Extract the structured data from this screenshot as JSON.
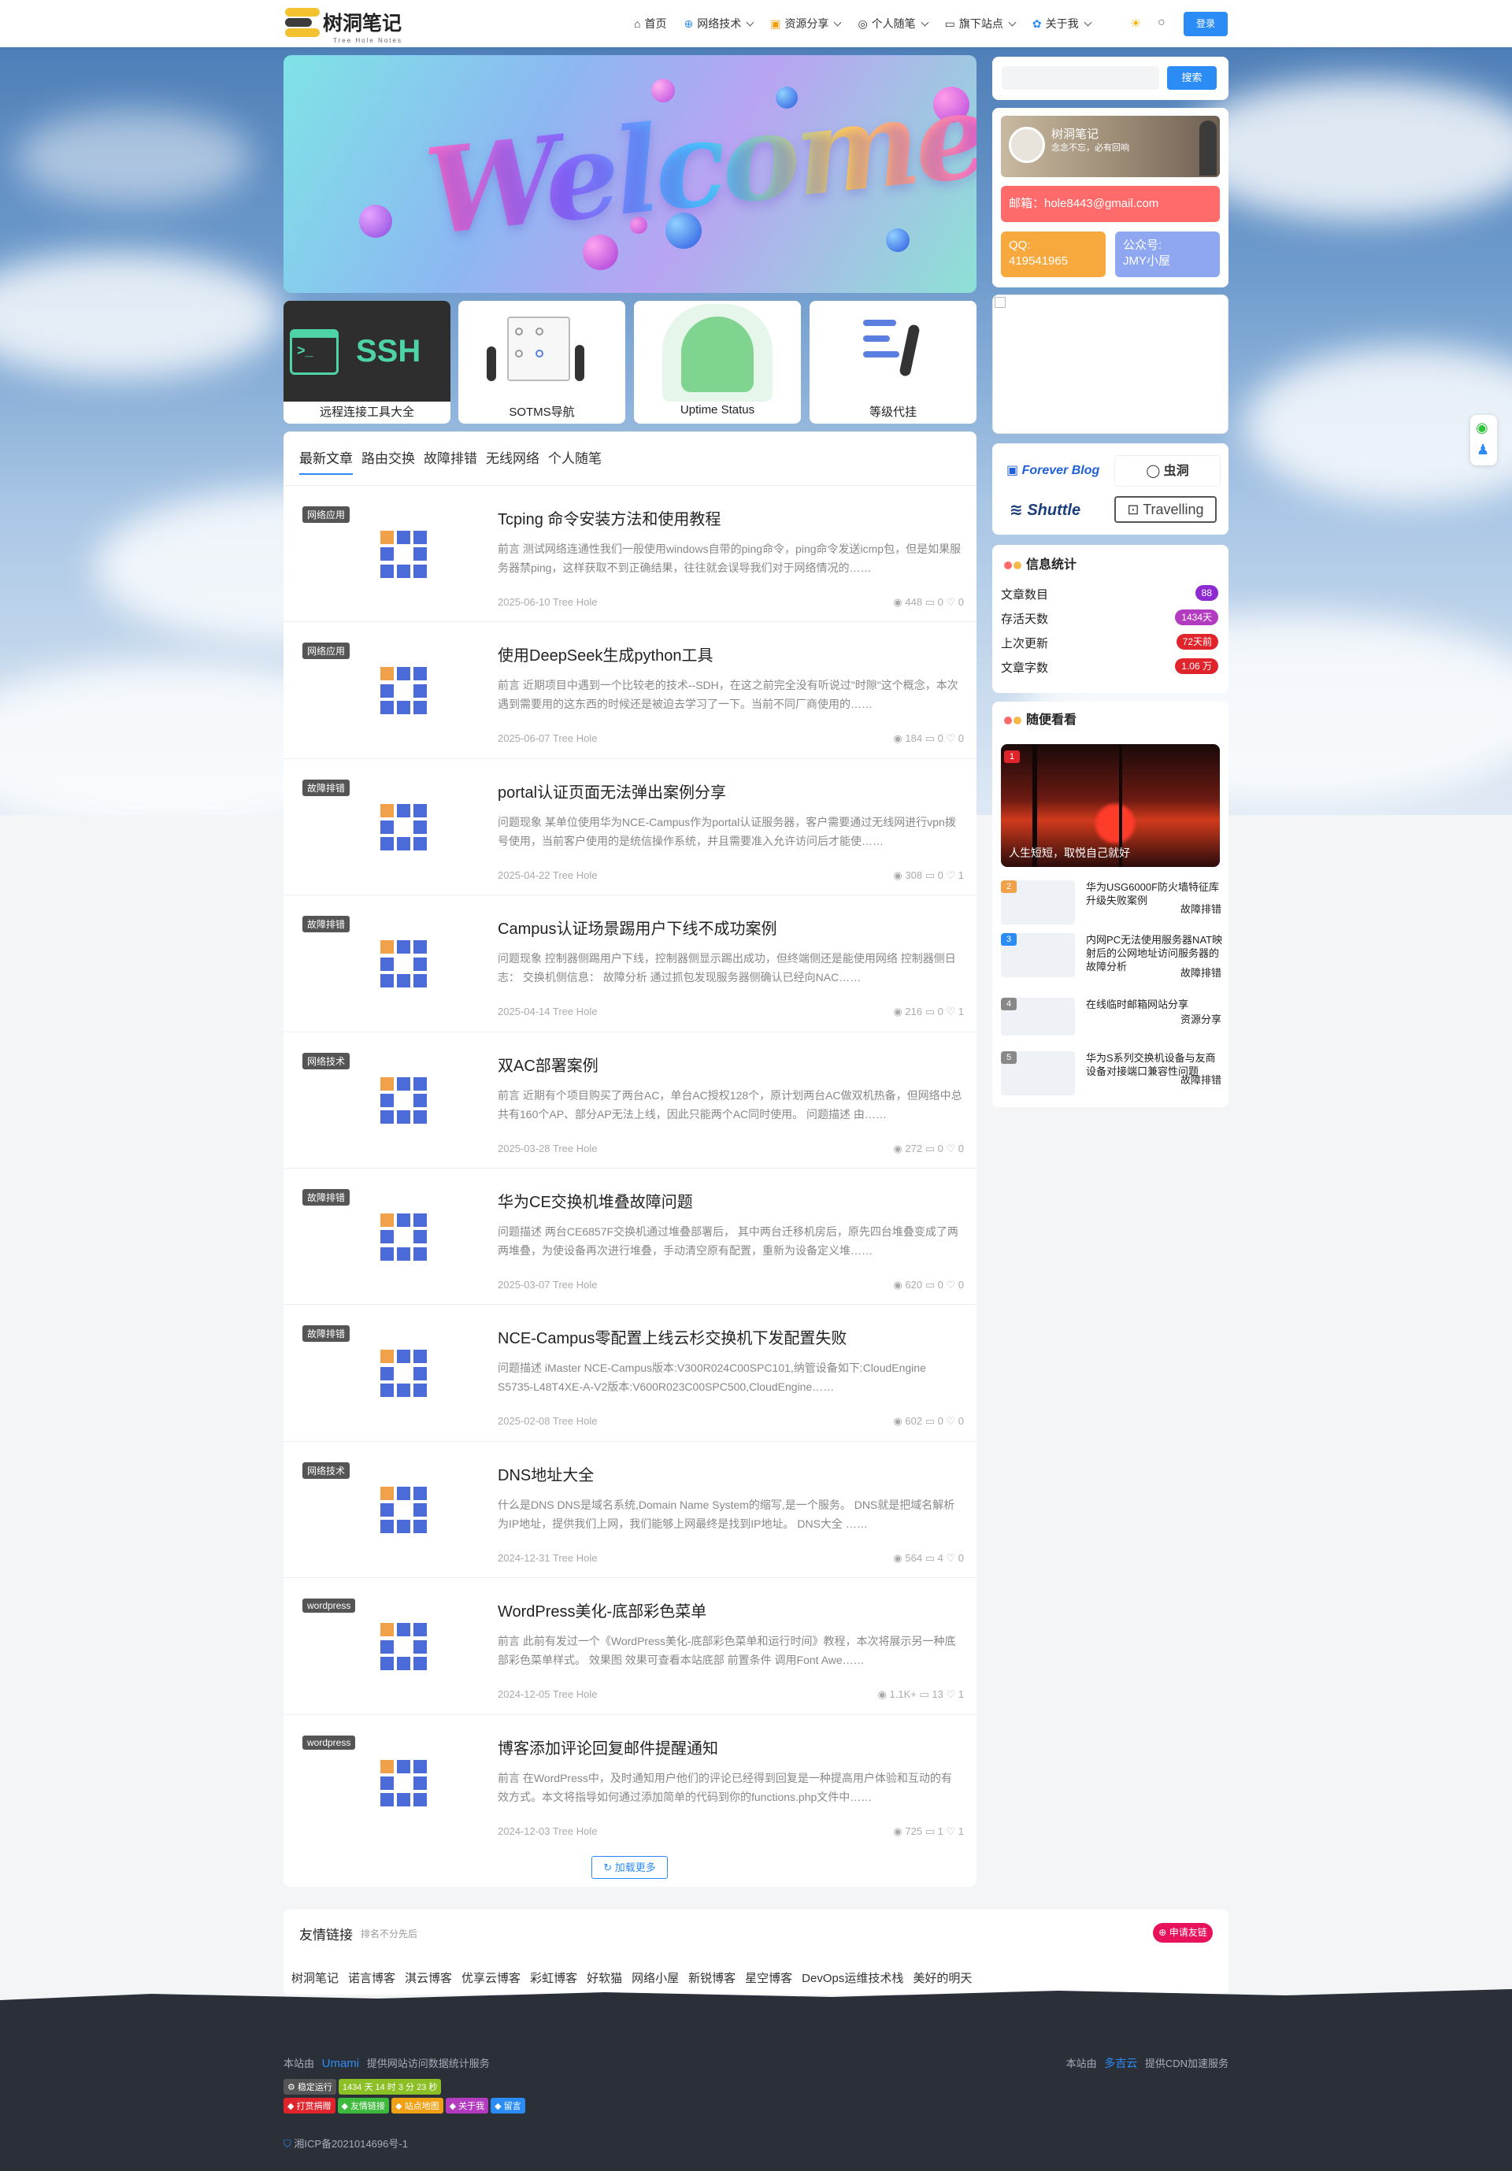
{
  "header": {
    "logo_text": "树洞笔记",
    "logo_sub": "Tree Hole Notes",
    "nav": [
      {
        "label": "首页",
        "icon": "home-icon",
        "dropdown": false
      },
      {
        "label": "网络技术",
        "icon": "globe-icon",
        "dropdown": true
      },
      {
        "label": "资源分享",
        "icon": "folder-icon",
        "dropdown": true
      },
      {
        "label": "个人随笔",
        "icon": "compass-icon",
        "dropdown": true
      },
      {
        "label": "旗下站点",
        "icon": "monitor-icon",
        "dropdown": true
      },
      {
        "label": "关于我",
        "icon": "paw-icon",
        "dropdown": true
      }
    ],
    "login_label": "登录"
  },
  "banner": {
    "text": "Welcome"
  },
  "quick_links": [
    {
      "label": "远程连接工具大全",
      "art": "SSH"
    },
    {
      "label": "SOTMS导航",
      "art": ""
    },
    {
      "label": "Uptime Status",
      "art": ""
    },
    {
      "label": "等级代挂",
      "art": ""
    }
  ],
  "tabs": [
    "最新文章",
    "路由交换",
    "故障排错",
    "无线网络",
    "个人随笔"
  ],
  "posts": [
    {
      "category": "网络应用",
      "title": "Tcping 命令安装方法和使用教程",
      "excerpt": "前言 测试网络连通性我们一般使用windows自带的ping命令，ping命令发送icmp包，但是如果服务器禁ping，这样获取不到正确结果，往往就会误导我们对于网络情况的……",
      "date": "2025-06-10",
      "author": "Tree Hole",
      "views": "448",
      "comments": "0",
      "likes": "0"
    },
    {
      "category": "网络应用",
      "title": "使用DeepSeek生成python工具",
      "excerpt": "前言 近期项目中遇到一个比较老的技术--SDH，在这之前完全没有听说过\"时隙\"这个概念，本次遇到需要用的这东西的时候还是被迫去学习了一下。当前不同厂商使用的……",
      "date": "2025-06-07",
      "author": "Tree Hole",
      "views": "184",
      "comments": "0",
      "likes": "0"
    },
    {
      "category": "故障排错",
      "title": "portal认证页面无法弹出案例分享",
      "excerpt": "问题现象 某单位使用华为NCE-Campus作为portal认证服务器，客户需要通过无线网进行vpn拨号使用，当前客户使用的是统信操作系统，并且需要准入允许访问后才能使……",
      "date": "2025-04-22",
      "author": "Tree Hole",
      "views": "308",
      "comments": "0",
      "likes": "1"
    },
    {
      "category": "故障排错",
      "title": "Campus认证场景踢用户下线不成功案例",
      "excerpt": "问题现象 控制器侧踢用户下线，控制器侧显示踢出成功，但终端侧还是能使用网络 控制器侧日志： 交换机侧信息： 故障分析 通过抓包发现服务器侧确认已经向NAC……",
      "date": "2025-04-14",
      "author": "Tree Hole",
      "views": "216",
      "comments": "0",
      "likes": "1"
    },
    {
      "category": "网络技术",
      "title": "双AC部署案例",
      "excerpt": "前言 近期有个项目购买了两台AC，单台AC授权128个，原计划两台AC做双机热备，但网络中总共有160个AP、部分AP无法上线，因此只能两个AC同时使用。 问题描述 由……",
      "date": "2025-03-28",
      "author": "Tree Hole",
      "views": "272",
      "comments": "0",
      "likes": "0"
    },
    {
      "category": "故障排错",
      "title": "华为CE交换机堆叠故障问题",
      "excerpt": "问题描述 两台CE6857F交换机通过堆叠部署后， 其中两台迁移机房后，原先四台堆叠变成了两两堆叠，为使设备再次进行堆叠，手动清空原有配置，重新为设备定义堆……",
      "date": "2025-03-07",
      "author": "Tree Hole",
      "views": "620",
      "comments": "0",
      "likes": "0"
    },
    {
      "category": "故障排错",
      "title": "NCE-Campus零配置上线云杉交换机下发配置失败",
      "excerpt": "问题描述 iMaster NCE-Campus版本:V300R024C00SPC101,纳管设备如下:CloudEngine S5735-L48T4XE-A-V2版本:V600R023C00SPC500,CloudEngine……",
      "date": "2025-02-08",
      "author": "Tree Hole",
      "views": "602",
      "comments": "0",
      "likes": "0"
    },
    {
      "category": "网络技术",
      "title": "DNS地址大全",
      "excerpt": "什么是DNS DNS是域名系统,Domain Name System的缩写,是一个服务。 DNS就是把域名解析为IP地址，提供我们上网，我们能够上网最终是找到IP地址。 DNS大全 ……",
      "date": "2024-12-31",
      "author": "Tree Hole",
      "views": "564",
      "comments": "4",
      "likes": "0"
    },
    {
      "category": "wordpress",
      "title": "WordPress美化-底部彩色菜单",
      "excerpt": "前言 此前有发过一个《WordPress美化-底部彩色菜单和运行时间》教程，本次将展示另一种底部彩色菜单样式。 效果图 效果可查看本站底部 前置条件 调用Font Awe……",
      "date": "2024-12-05",
      "author": "Tree Hole",
      "views": "1.1K+",
      "comments": "13",
      "likes": "1"
    },
    {
      "category": "wordpress",
      "title": "博客添加评论回复邮件提醒通知",
      "excerpt": "前言 在WordPress中，及时通知用户他们的评论已经得到回复是一种提高用户体验和互动的有效方式。本文将指导如何通过添加简单的代码到你的functions.php文件中……",
      "date": "2024-12-03",
      "author": "Tree Hole",
      "views": "725",
      "comments": "1",
      "likes": "1"
    }
  ],
  "load_more_label": "加载更多",
  "sidebar": {
    "search_button": "搜索",
    "profile": {
      "name": "树洞笔记",
      "motto": "念念不忘，必有回响",
      "email": "邮箱：hole8443@gmail.com",
      "qq": "QQ:\n419541965",
      "wechat": "公众号:\nJMY小屋"
    },
    "sponsors": [
      "Forever Blog",
      "虫洞",
      "Shuttle",
      "Travelling"
    ],
    "stats": {
      "title": "信息统计",
      "rows": [
        {
          "label": "文章数目",
          "value": "88",
          "color": "#8e2bd1"
        },
        {
          "label": "存活天数",
          "value": "1434天",
          "color": "#b33bc0"
        },
        {
          "label": "上次更新",
          "value": "72天前",
          "color": "#e0242c"
        },
        {
          "label": "文章字数",
          "value": "1.06 万",
          "color": "#e0242c"
        }
      ]
    },
    "random": {
      "title": "随便看看",
      "hero_caption": "人生短短，取悦自己就好",
      "hero_num": "1",
      "items": [
        {
          "num": "2",
          "title": "华为USG6000F防火墙特征库升级失败案例",
          "category": "故障排错",
          "color": "#f0a14a"
        },
        {
          "num": "3",
          "title": "内网PC无法使用服务器NAT映射后的公网地址访问服务器的故障分析",
          "category": "故障排错",
          "color": "#2b8cf6"
        },
        {
          "num": "4",
          "title": "在线临时邮箱网站分享",
          "category": "资源分享",
          "color": "#888"
        },
        {
          "num": "5",
          "title": "华为S系列交换机设备与友商设备对接端口兼容性问题",
          "category": "故障排错",
          "color": "#888"
        }
      ]
    }
  },
  "friends": {
    "title": "友情链接",
    "subtitle": "排名不分先后",
    "apply_label": "申请友链",
    "links": [
      "树洞笔记",
      "诺言博客",
      "淇云博客",
      "优享云博客",
      "彩虹博客",
      "好软猫",
      "网络小屋",
      "新锐博客",
      "星空博客",
      "DevOps运维技术栈",
      "美好的明天"
    ]
  },
  "footer": {
    "stats_prefix": "本站由",
    "stats_brand": "Umami",
    "stats_suffix": "提供网站访问数据统计服务",
    "cdn_prefix": "本站由",
    "cdn_brand": "多吉云",
    "cdn_suffix": "提供CDN加速服务",
    "run_label": "稳定运行",
    "run_time": "1434 天 14 时 3 分 23 秒",
    "menu": [
      {
        "label": "打赏捐赠",
        "color": "#e0242c"
      },
      {
        "label": "友情链接",
        "color": "#3db93d"
      },
      {
        "label": "站点地图",
        "color": "#f0a014"
      },
      {
        "label": "关于我",
        "color": "#b33bc0"
      },
      {
        "label": "留言",
        "color": "#2b8cf6"
      }
    ],
    "icp": "湘ICP备2021014696号-1"
  }
}
